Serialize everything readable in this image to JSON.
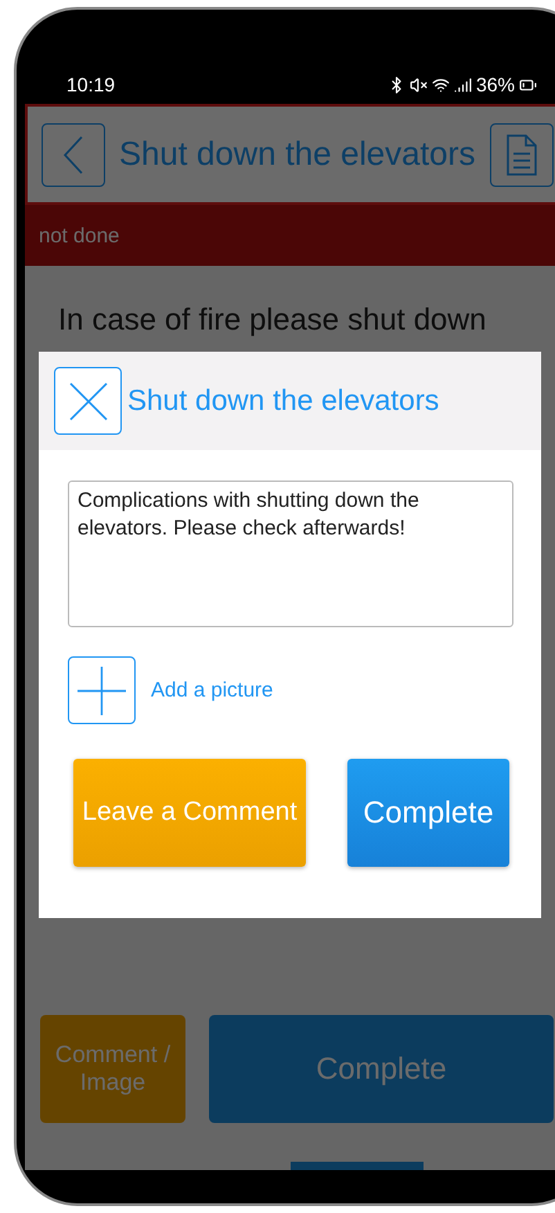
{
  "status_bar": {
    "time": "10:19",
    "battery": "36%"
  },
  "header": {
    "title": "Shut down the elevators"
  },
  "task_status": {
    "label": "not done"
  },
  "description": "In case of fire please shut down",
  "footer_buttons": [
    {
      "label": "Comment / Image",
      "kind": "comment"
    },
    {
      "label": "Complete",
      "kind": "complete"
    }
  ],
  "dialog": {
    "title": "Shut down the elevators",
    "comment": {
      "value": "Complications with shutting down the elevators. Please check afterwards!"
    },
    "add_picture": "Add a picture",
    "buttons": [
      {
        "label": "Leave a Comment",
        "kind": "comment"
      },
      {
        "label": "Complete",
        "kind": "complete"
      }
    ]
  }
}
